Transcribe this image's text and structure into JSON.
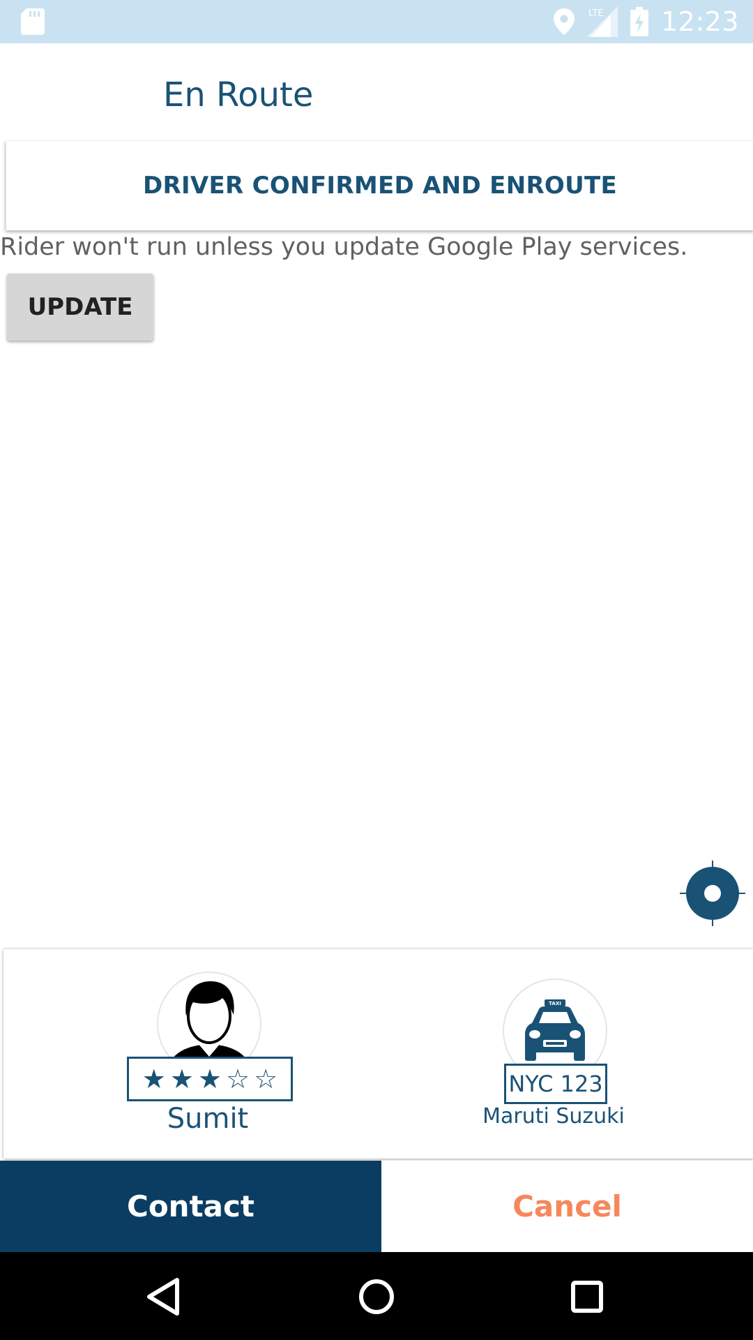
{
  "status_bar": {
    "time": "12:23",
    "network": "LTE",
    "icons": [
      "sd-card-icon",
      "location-icon",
      "signal-icon",
      "battery-charging-icon"
    ]
  },
  "toolbar": {
    "title": "En Route"
  },
  "status_card": {
    "text": "DRIVER CONFIRMED AND ENROUTE"
  },
  "gps_warning": {
    "message": "Rider won't run unless you update Google Play services.",
    "button_label": "UPDATE"
  },
  "driver": {
    "name": "Sumit",
    "rating": 3,
    "rating_max": 5,
    "stars": [
      "★",
      "★",
      "★",
      "☆",
      "☆"
    ],
    "vehicle_plate": "NYC 123",
    "vehicle_model": "Maruti Suzuki"
  },
  "actions": {
    "contact_label": "Contact",
    "cancel_label": "Cancel"
  },
  "colors": {
    "primary": "#1a5276",
    "primary_dark": "#0b3d63",
    "accent": "#f4885b",
    "status_bar": "#c9e2f2"
  },
  "nav_bar": {
    "icons": [
      "back-icon",
      "home-icon",
      "recents-icon"
    ]
  }
}
